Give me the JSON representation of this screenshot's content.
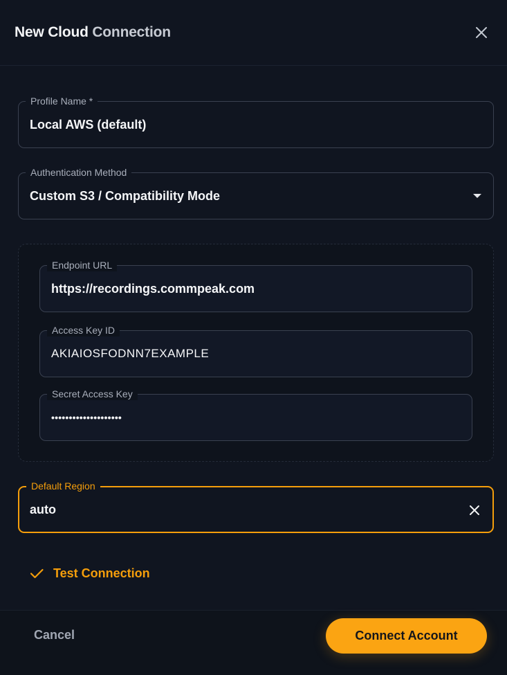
{
  "dialog": {
    "title_main": "New Cloud",
    "title_rest": "Connection"
  },
  "form": {
    "profile_name": {
      "label": "Profile Name *",
      "value": "Local AWS (default)"
    },
    "auth_method": {
      "label": "Authentication Method",
      "value": "Custom S3 / Compatibility Mode"
    },
    "endpoint_url": {
      "label": "Endpoint URL",
      "value": "https://recordings.commpeak.com"
    },
    "access_key_id": {
      "label": "Access Key ID",
      "value": "AKIAIOSFODNN7EXAMPLE"
    },
    "secret_access_key": {
      "label": "Secret Access Key",
      "value": "••••••••••••••••••••"
    },
    "default_region": {
      "label": "Default Region",
      "value": "auto"
    }
  },
  "actions": {
    "test_connection": "Test Connection",
    "cancel": "Cancel",
    "connect": "Connect Account"
  },
  "colors": {
    "accent": "#f59e0b",
    "button": "#fba412",
    "background": "#101520"
  },
  "icons": {
    "close": "close-icon",
    "dropdown": "chevron-down-icon",
    "clear": "clear-icon",
    "check": "check-icon"
  }
}
